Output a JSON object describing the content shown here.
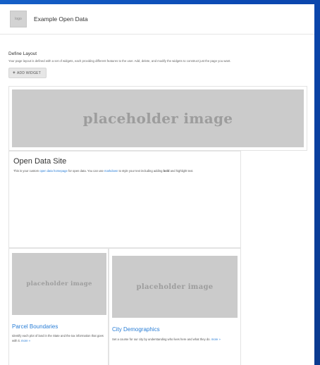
{
  "header": {
    "logo_text": "logo",
    "site_title": "Example Open Data"
  },
  "layout": {
    "title": "Define Layout",
    "description": "Your page layout is defined with a set of widgets, each providing different features to the user. Add, delete, and modify the widgets to construct just the page you want.",
    "add_widget_label": "ADD WIDGET"
  },
  "banner": {
    "placeholder": "placeholder image"
  },
  "intro": {
    "title": "Open Data Site",
    "text_before_link1": "This is your custom ",
    "link1": "open data homepage",
    "text_between_links": " for open data. You can use ",
    "link2": "markdown",
    "text_after_link2": " to style your text including adding ",
    "bold": "bold",
    "text_end": " and highlight text."
  },
  "cards": [
    {
      "placeholder": "placeholder image",
      "title": "Parcel Boundaries",
      "description": "Identify each plot of land in the State and the tax information that goes with it.",
      "more": "more »"
    },
    {
      "placeholder": "placeholder image",
      "title": "City Demographics",
      "description": "Set a course for our city by understanding who lives here and what they do.",
      "more": "more »"
    }
  ],
  "colors": {
    "background": "#0b49b3",
    "link": "#2a7ed6",
    "placeholder": "#cbcbcb"
  }
}
